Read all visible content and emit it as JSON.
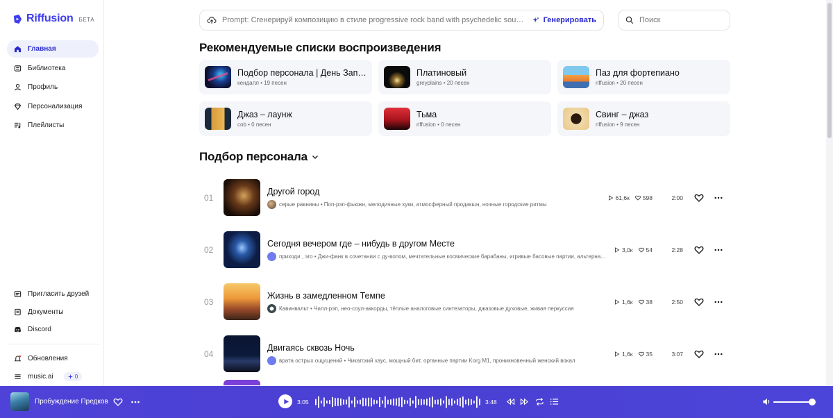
{
  "brand": {
    "name": "Riffusion",
    "badge": "БЕТА",
    "accent": "#3d3df0"
  },
  "nav": {
    "items": [
      {
        "label": "Главная",
        "icon": "home-icon",
        "active": true
      },
      {
        "label": "Библиотека",
        "icon": "library-icon"
      },
      {
        "label": "Профиль",
        "icon": "profile-icon"
      },
      {
        "label": "Персонализация",
        "icon": "gem-icon"
      },
      {
        "label": "Плейлисты",
        "icon": "playlist-icon"
      }
    ],
    "bottom": [
      {
        "label": "Пригласить друзей",
        "icon": "invite-icon"
      },
      {
        "label": "Документы",
        "icon": "document-icon"
      },
      {
        "label": "Discord",
        "icon": "discord-icon"
      }
    ],
    "updates": "Обновления",
    "account": {
      "name": "music.ai",
      "credits": "0"
    }
  },
  "prompt": {
    "text": "Prompt: Сгенерируй композицию в стиле progressive rock band with psychedelic sound...",
    "button": "Генерировать"
  },
  "search": {
    "placeholder": "Поиск"
  },
  "sections": {
    "featured": "Рекомендуемые списки воспроизведения",
    "personal": "Подбор персонала"
  },
  "playlists": [
    {
      "title": "Подбор персонала | День Запуска",
      "author": "кендалл",
      "count": "19 песен"
    },
    {
      "title": "Платиновый",
      "author": "greyplains",
      "count": "20 песен"
    },
    {
      "title": "Паз для фортепиано",
      "author": "riffusion",
      "count": "20 песен"
    },
    {
      "title": "Джаз – лаунж",
      "author": "cob",
      "count": "0 песен"
    },
    {
      "title": "Тьма",
      "author": "riffusion",
      "count": "0 песен"
    },
    {
      "title": "Свинг – джаз",
      "author": "riffusion",
      "count": "9 песен"
    }
  ],
  "tracks": [
    {
      "num": "01",
      "title": "Другой город",
      "artist": "серые равнины",
      "tags": "Поп-рэп-фьюжн, мелодичные хуки, атмосферный продакшн, ночные городские ритмы",
      "plays": "61,6к",
      "likes": "598",
      "duration": "2:00"
    },
    {
      "num": "02",
      "title": "Сегодня вечером где – нибудь в другом Месте",
      "artist": "приходи , эго",
      "tags": "Джи-фанк в сочетании с ду-вопом, мечтательные космические барабаны, игривые басовые партии, альтернативный вокал",
      "plays": "3,0к",
      "likes": "54",
      "duration": "2:28"
    },
    {
      "num": "03",
      "title": "Жизнь в замедленном Темпе",
      "artist": "Кавинвальт",
      "tags": "Чилл-рэп, нео-соул-аккорды, тёплые аналоговые синтезаторы, джазовые духовые, живая перкуссия",
      "plays": "1,6к",
      "likes": "38",
      "duration": "2:50"
    },
    {
      "num": "04",
      "title": "Двигаясь сквозь Ночь",
      "artist": "врата острых ощущений",
      "tags": "Чикагский хаус, мощный бит, органные партии Korg M1, проникновенный женский вокал",
      "plays": "1,6к",
      "likes": "35",
      "duration": "3:07"
    }
  ],
  "player": {
    "title": "Пробуждение Предков",
    "current": "3:05",
    "total": "3:48",
    "progress": 0.0,
    "volume": 0.92,
    "bar_color": "#4e42d8"
  }
}
